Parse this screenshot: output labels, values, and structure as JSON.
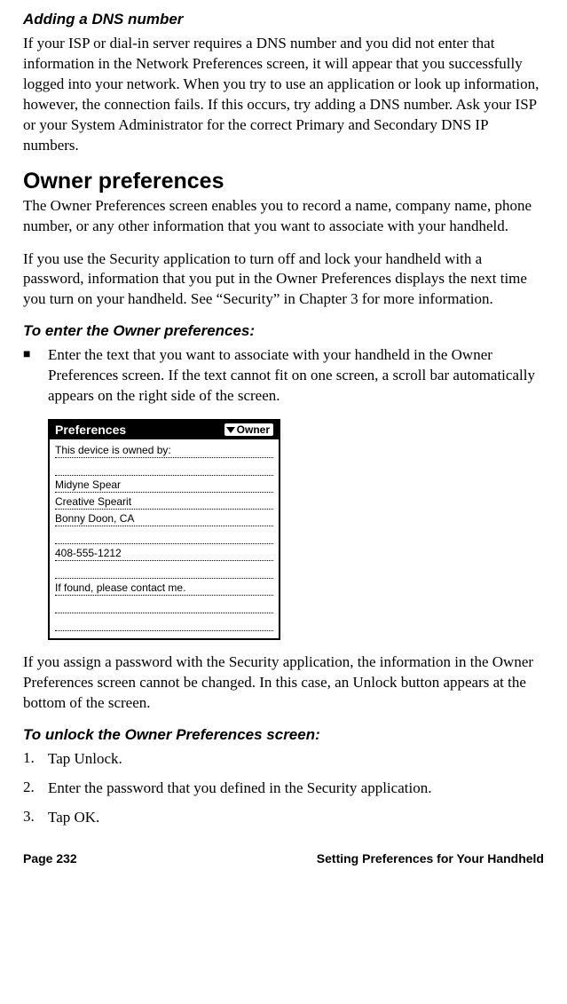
{
  "section1": {
    "heading": "Adding a DNS number",
    "p1": "If your ISP or dial-in server requires a DNS number and you did not enter that information in the Network Preferences screen, it will appear that you successfully logged into your network. When you try to use an application or look up information, however, the connection fails. If this occurs, try adding a DNS number. Ask your ISP or your System Administrator for the correct Primary and Secondary DNS IP numbers."
  },
  "section2": {
    "heading": "Owner preferences",
    "p1": "The Owner Preferences screen enables you to record a name, company name, phone number, or any other information that you want to associate with your handheld.",
    "p2": "If you use the Security application to turn off and lock your handheld with a password, information that you put in the Owner Preferences displays the next time you turn on your handheld. See “Security” in Chapter 3 for more information.",
    "sub1": "To enter the Owner preferences:",
    "bullet1": "Enter the text that you want to associate with your handheld in the Owner Preferences screen. If the text cannot fit on one screen, a scroll bar automatically appears on the right side of the screen.",
    "p3": "If you assign a password with the Security application, the information in the Owner Preferences screen cannot be changed. In this case, an Unlock button appears at the bottom of the screen.",
    "sub2": "To unlock the Owner Preferences screen:",
    "step1": "Tap Unlock.",
    "step2": "Enter the password that you defined in the Security application.",
    "step3": "Tap OK."
  },
  "figure": {
    "title": "Preferences",
    "drop": "Owner",
    "line1": "This device is owned by:",
    "line2": "Midyne Spear",
    "line3": "Creative Spearit",
    "line4": "Bonny Doon, CA",
    "line5": "408-555-1212",
    "line6": "If found, please contact me."
  },
  "footer": {
    "left": "Page 232",
    "right": "Setting Preferences for Your Handheld"
  }
}
